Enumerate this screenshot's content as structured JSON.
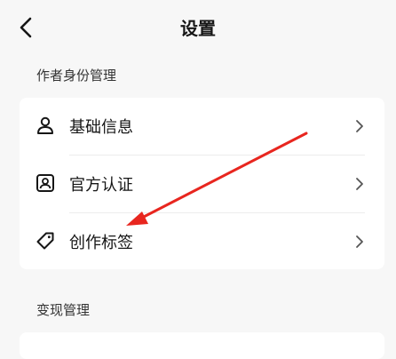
{
  "header": {
    "title": "设置",
    "back_icon": "chevron-left-icon"
  },
  "sections": [
    {
      "label": "作者身份管理",
      "items": [
        {
          "label": "基础信息",
          "icon": "person-icon"
        },
        {
          "label": "官方认证",
          "icon": "id-badge-icon"
        },
        {
          "label": "创作标签",
          "icon": "tag-icon"
        }
      ]
    },
    {
      "label": "变现管理"
    }
  ],
  "colors": {
    "background": "#f7f7f7",
    "card": "#ffffff",
    "annotation_arrow": "#e8261f"
  }
}
